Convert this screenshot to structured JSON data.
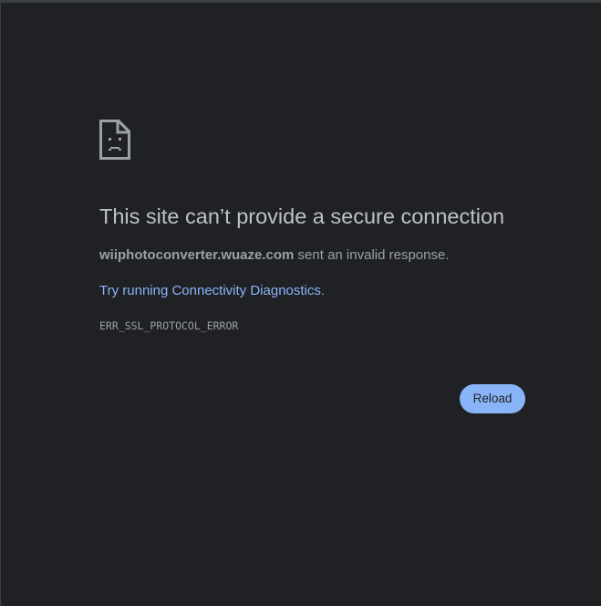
{
  "error_page": {
    "icon": "sad-page-icon",
    "headline": "This site can’t provide a secure connection",
    "host": "wiiphotoconverter.wuaze.com",
    "summary_suffix": " sent an invalid response.",
    "suggestion_link": "Try running Connectivity Diagnostics",
    "suggestion_suffix": ".",
    "error_code": "ERR_SSL_PROTOCOL_ERROR",
    "reload_label": "Reload"
  },
  "colors": {
    "background": "#202124",
    "text": "#9aa0a6",
    "headline": "#bdc1c6",
    "link": "#8ab4f8",
    "button_bg": "#8ab4f8"
  }
}
